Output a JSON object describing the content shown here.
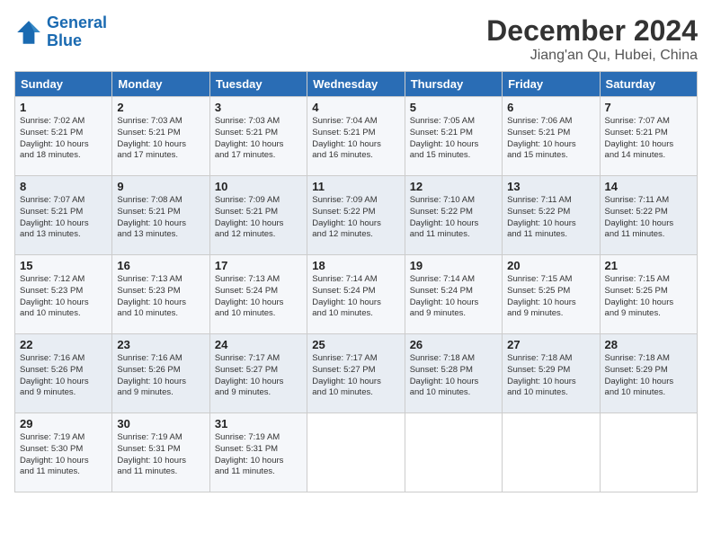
{
  "logo": {
    "line1": "General",
    "line2": "Blue"
  },
  "title": "December 2024",
  "location": "Jiang'an Qu, Hubei, China",
  "weekdays": [
    "Sunday",
    "Monday",
    "Tuesday",
    "Wednesday",
    "Thursday",
    "Friday",
    "Saturday"
  ],
  "weeks": [
    [
      {
        "day": "1",
        "info": "Sunrise: 7:02 AM\nSunset: 5:21 PM\nDaylight: 10 hours\nand 18 minutes."
      },
      {
        "day": "2",
        "info": "Sunrise: 7:03 AM\nSunset: 5:21 PM\nDaylight: 10 hours\nand 17 minutes."
      },
      {
        "day": "3",
        "info": "Sunrise: 7:03 AM\nSunset: 5:21 PM\nDaylight: 10 hours\nand 17 minutes."
      },
      {
        "day": "4",
        "info": "Sunrise: 7:04 AM\nSunset: 5:21 PM\nDaylight: 10 hours\nand 16 minutes."
      },
      {
        "day": "5",
        "info": "Sunrise: 7:05 AM\nSunset: 5:21 PM\nDaylight: 10 hours\nand 15 minutes."
      },
      {
        "day": "6",
        "info": "Sunrise: 7:06 AM\nSunset: 5:21 PM\nDaylight: 10 hours\nand 15 minutes."
      },
      {
        "day": "7",
        "info": "Sunrise: 7:07 AM\nSunset: 5:21 PM\nDaylight: 10 hours\nand 14 minutes."
      }
    ],
    [
      {
        "day": "8",
        "info": "Sunrise: 7:07 AM\nSunset: 5:21 PM\nDaylight: 10 hours\nand 13 minutes."
      },
      {
        "day": "9",
        "info": "Sunrise: 7:08 AM\nSunset: 5:21 PM\nDaylight: 10 hours\nand 13 minutes."
      },
      {
        "day": "10",
        "info": "Sunrise: 7:09 AM\nSunset: 5:21 PM\nDaylight: 10 hours\nand 12 minutes."
      },
      {
        "day": "11",
        "info": "Sunrise: 7:09 AM\nSunset: 5:22 PM\nDaylight: 10 hours\nand 12 minutes."
      },
      {
        "day": "12",
        "info": "Sunrise: 7:10 AM\nSunset: 5:22 PM\nDaylight: 10 hours\nand 11 minutes."
      },
      {
        "day": "13",
        "info": "Sunrise: 7:11 AM\nSunset: 5:22 PM\nDaylight: 10 hours\nand 11 minutes."
      },
      {
        "day": "14",
        "info": "Sunrise: 7:11 AM\nSunset: 5:22 PM\nDaylight: 10 hours\nand 11 minutes."
      }
    ],
    [
      {
        "day": "15",
        "info": "Sunrise: 7:12 AM\nSunset: 5:23 PM\nDaylight: 10 hours\nand 10 minutes."
      },
      {
        "day": "16",
        "info": "Sunrise: 7:13 AM\nSunset: 5:23 PM\nDaylight: 10 hours\nand 10 minutes."
      },
      {
        "day": "17",
        "info": "Sunrise: 7:13 AM\nSunset: 5:24 PM\nDaylight: 10 hours\nand 10 minutes."
      },
      {
        "day": "18",
        "info": "Sunrise: 7:14 AM\nSunset: 5:24 PM\nDaylight: 10 hours\nand 10 minutes."
      },
      {
        "day": "19",
        "info": "Sunrise: 7:14 AM\nSunset: 5:24 PM\nDaylight: 10 hours\nand 9 minutes."
      },
      {
        "day": "20",
        "info": "Sunrise: 7:15 AM\nSunset: 5:25 PM\nDaylight: 10 hours\nand 9 minutes."
      },
      {
        "day": "21",
        "info": "Sunrise: 7:15 AM\nSunset: 5:25 PM\nDaylight: 10 hours\nand 9 minutes."
      }
    ],
    [
      {
        "day": "22",
        "info": "Sunrise: 7:16 AM\nSunset: 5:26 PM\nDaylight: 10 hours\nand 9 minutes."
      },
      {
        "day": "23",
        "info": "Sunrise: 7:16 AM\nSunset: 5:26 PM\nDaylight: 10 hours\nand 9 minutes."
      },
      {
        "day": "24",
        "info": "Sunrise: 7:17 AM\nSunset: 5:27 PM\nDaylight: 10 hours\nand 9 minutes."
      },
      {
        "day": "25",
        "info": "Sunrise: 7:17 AM\nSunset: 5:27 PM\nDaylight: 10 hours\nand 10 minutes."
      },
      {
        "day": "26",
        "info": "Sunrise: 7:18 AM\nSunset: 5:28 PM\nDaylight: 10 hours\nand 10 minutes."
      },
      {
        "day": "27",
        "info": "Sunrise: 7:18 AM\nSunset: 5:29 PM\nDaylight: 10 hours\nand 10 minutes."
      },
      {
        "day": "28",
        "info": "Sunrise: 7:18 AM\nSunset: 5:29 PM\nDaylight: 10 hours\nand 10 minutes."
      }
    ],
    [
      {
        "day": "29",
        "info": "Sunrise: 7:19 AM\nSunset: 5:30 PM\nDaylight: 10 hours\nand 11 minutes."
      },
      {
        "day": "30",
        "info": "Sunrise: 7:19 AM\nSunset: 5:31 PM\nDaylight: 10 hours\nand 11 minutes."
      },
      {
        "day": "31",
        "info": "Sunrise: 7:19 AM\nSunset: 5:31 PM\nDaylight: 10 hours\nand 11 minutes."
      },
      {
        "day": "",
        "info": ""
      },
      {
        "day": "",
        "info": ""
      },
      {
        "day": "",
        "info": ""
      },
      {
        "day": "",
        "info": ""
      }
    ]
  ]
}
